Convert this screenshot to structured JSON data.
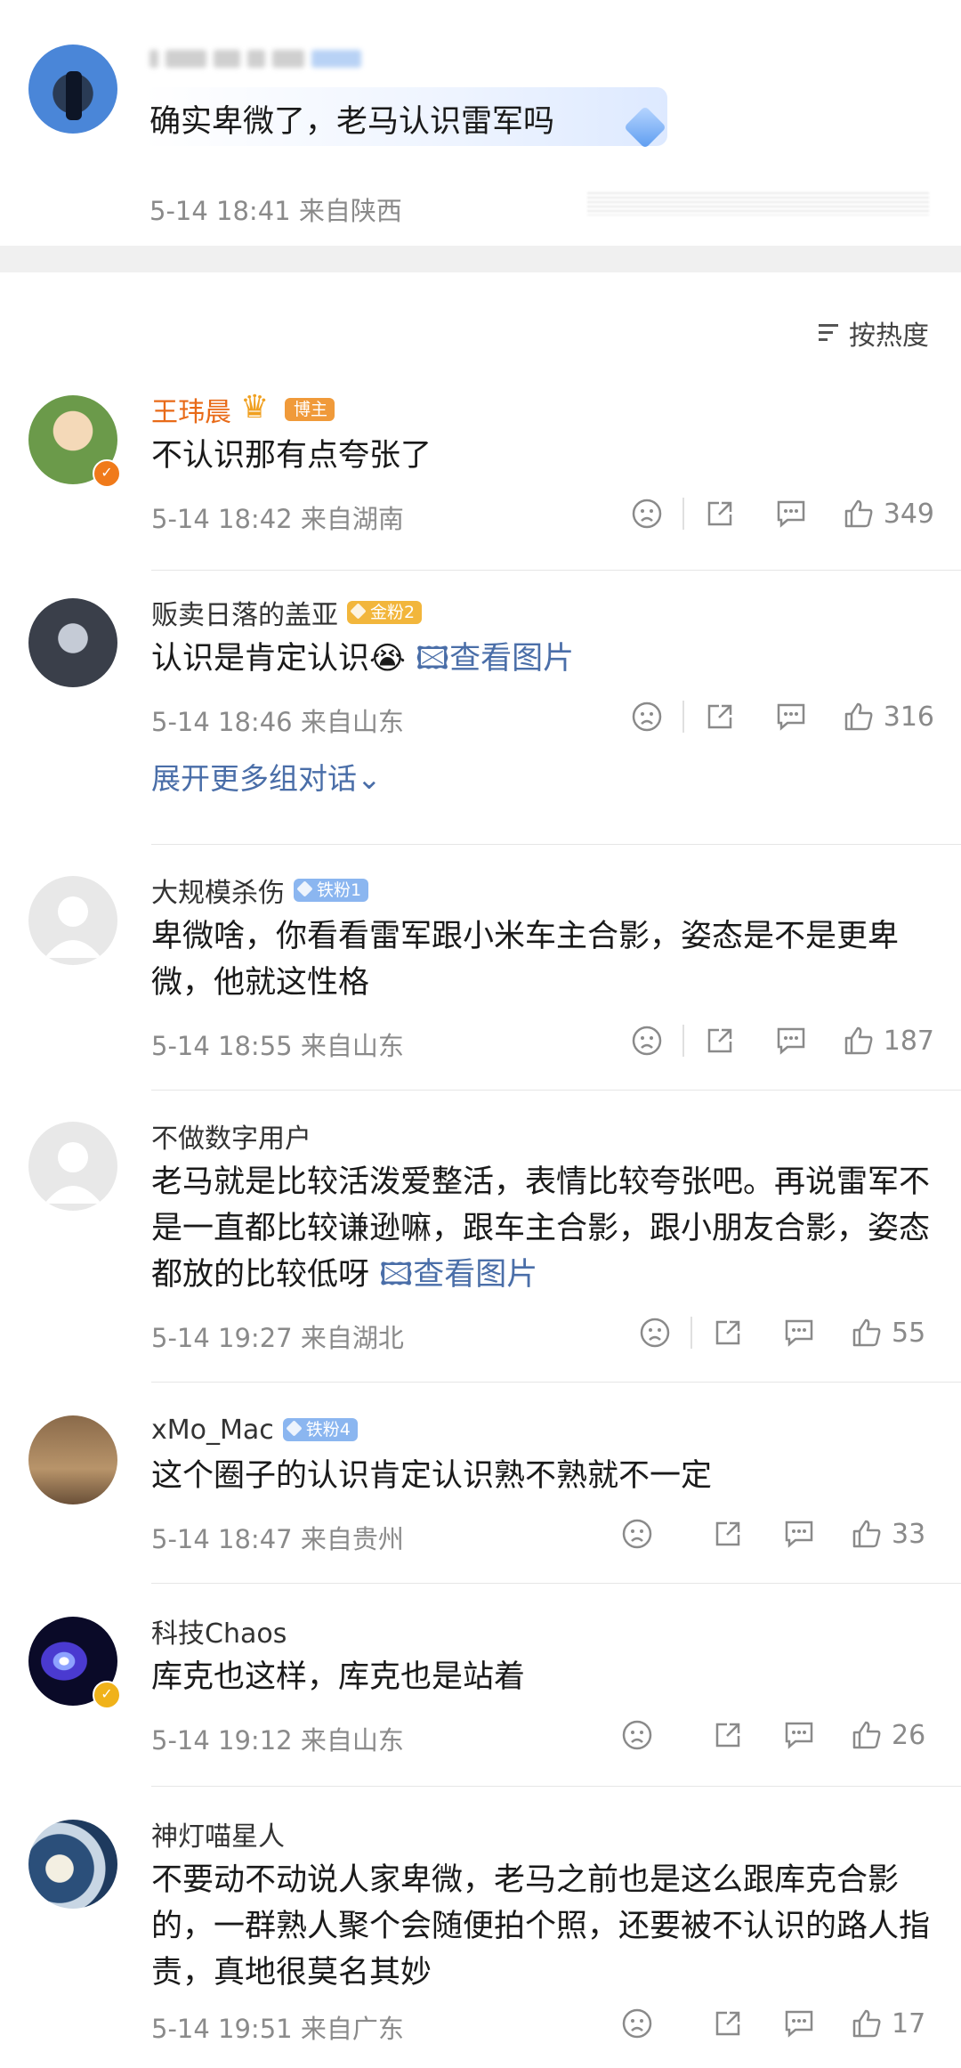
{
  "top_post": {
    "text": "确实卑微了，老马认识雷军吗",
    "time": "5-14 18:41",
    "location": "来自陕西"
  },
  "sort": {
    "label": "按热度"
  },
  "comments": [
    {
      "name": "王玮晨",
      "badge": "博主",
      "badge_type": "host",
      "text": "不认识那有点夸张了",
      "link": "",
      "time": "5-14 18:42",
      "location": "来自湖南",
      "likes": "349"
    },
    {
      "name": "贩卖日落的盖亚",
      "badge": "金粉2",
      "badge_type": "gold",
      "text": "认识是肯定认识😭",
      "link": "查看图片",
      "time": "5-14 18:46",
      "location": "来自山东",
      "likes": "316",
      "expand": "展开更多组对话⌄"
    },
    {
      "name": "大规模杀伤",
      "badge": "铁粉1",
      "badge_type": "iron",
      "text": "卑微啥，你看看雷军跟小米车主合影，姿态是不是更卑微，他就这性格",
      "link": "",
      "time": "5-14 18:55",
      "location": "来自山东",
      "likes": "187"
    },
    {
      "name": "不做数字用户",
      "badge": "",
      "text": "老马就是比较活泼爱整活，表情比较夸张吧。再说雷军不是一直都比较谦逊嘛，跟车主合影，跟小朋友合影，姿态都放的比较低呀",
      "link": "查看图片",
      "time": "5-14 19:27",
      "location": "来自湖北",
      "likes": "55"
    },
    {
      "name": "xMo_Mac",
      "badge": "铁粉4",
      "badge_type": "iron",
      "text": "这个圈子的认识肯定认识熟不熟就不一定",
      "link": "",
      "time": "5-14 18:47",
      "location": "来自贵州",
      "likes": "33"
    },
    {
      "name": "科技Chaos",
      "badge": "",
      "text": "库克也这样，库克也是站着",
      "link": "",
      "time": "5-14 19:12",
      "location": "来自山东",
      "likes": "26"
    },
    {
      "name": "神灯喵星人",
      "badge": "",
      "text": "不要动不动说人家卑微，老马之前也是这么跟库克合影的，一群熟人聚个会随便拍个照，还要被不认识的路人指责，真地很莫名其妙",
      "link": "",
      "time": "5-14 19:51",
      "location": "来自广东",
      "likes": "17"
    }
  ],
  "icons": {
    "dislike": "sad-face-icon",
    "share": "share-icon",
    "reply": "reply-bubble-icon",
    "like": "thumbs-up-icon"
  },
  "colors": {
    "link": "#4a6ea8",
    "host_name": "#e86a18",
    "meta": "#8a8a8a"
  }
}
